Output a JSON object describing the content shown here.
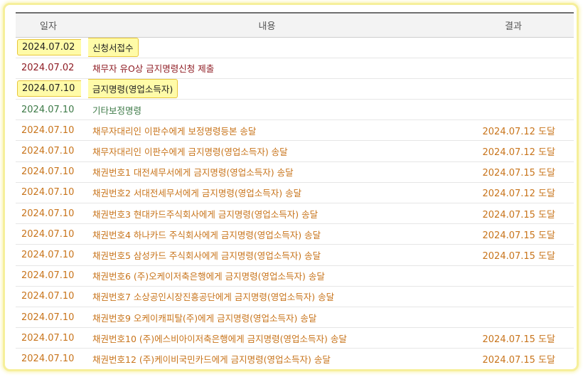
{
  "table": {
    "headers": {
      "date": "일자",
      "content": "내용",
      "result": "결과"
    },
    "rows": [
      {
        "date": "2024.07.02",
        "content": "신청서접수",
        "result": "",
        "kind": "black",
        "highlight": true
      },
      {
        "date": "2024.07.02",
        "content": "채무자 유O상 금지명령신청 제출",
        "result": "",
        "kind": "maroon",
        "highlight": false
      },
      {
        "date": "2024.07.10",
        "content": "금지명령(영업소득자)",
        "result": "",
        "kind": "black",
        "highlight": true
      },
      {
        "date": "2024.07.10",
        "content": "기타보정명령",
        "result": "",
        "kind": "green",
        "highlight": false
      },
      {
        "date": "2024.07.10",
        "content": "채무자대리인 이판수에게 보정명령등본 송달",
        "result": "2024.07.12 도달",
        "kind": "orange",
        "highlight": false
      },
      {
        "date": "2024.07.10",
        "content": "채무자대리인 이판수에게 금지명령(영업소득자) 송달",
        "result": "2024.07.12 도달",
        "kind": "orange",
        "highlight": false
      },
      {
        "date": "2024.07.10",
        "content": "채권번호1 대전세무서에게 금지명령(영업소득자) 송달",
        "result": "2024.07.15 도달",
        "kind": "orange",
        "highlight": false
      },
      {
        "date": "2024.07.10",
        "content": "채권번호2 서대전세무서에게 금지명령(영업소득자) 송달",
        "result": "2024.07.12 도달",
        "kind": "orange",
        "highlight": false
      },
      {
        "date": "2024.07.10",
        "content": "채권번호3 현대카드주식회사에게 금지명령(영업소득자) 송달",
        "result": "2024.07.15 도달",
        "kind": "orange",
        "highlight": false
      },
      {
        "date": "2024.07.10",
        "content": "채권번호4 하나카드 주식회사에게 금지명령(영업소득자) 송달",
        "result": "2024.07.15 도달",
        "kind": "orange",
        "highlight": false
      },
      {
        "date": "2024.07.10",
        "content": "채권번호5 삼성카드 주식회사에게 금지명령(영업소득자) 송달",
        "result": "2024.07.15 도달",
        "kind": "orange",
        "highlight": false
      },
      {
        "date": "2024.07.10",
        "content": "채권번호6 (주)오케이저축은행에게 금지명령(영업소득자) 송달",
        "result": "",
        "kind": "orange",
        "highlight": false
      },
      {
        "date": "2024.07.10",
        "content": "채권번호7 소상공인시장진흥공단에게 금지명령(영업소득자) 송달",
        "result": "",
        "kind": "orange",
        "highlight": false
      },
      {
        "date": "2024.07.10",
        "content": "채권번호9 오케이캐피탈(주)에게 금지명령(영업소득자) 송달",
        "result": "",
        "kind": "orange",
        "highlight": false
      },
      {
        "date": "2024.07.10",
        "content": "채권번호10 (주)에스비아이저축은행에게 금지명령(영업소득자) 송달",
        "result": "2024.07.15 도달",
        "kind": "orange",
        "highlight": false
      },
      {
        "date": "2024.07.10",
        "content": "채권번호12 (주)케이비국민카드에게 금지명령(영업소득자) 송달",
        "result": "2024.07.15 도달",
        "kind": "orange",
        "highlight": false
      }
    ]
  }
}
